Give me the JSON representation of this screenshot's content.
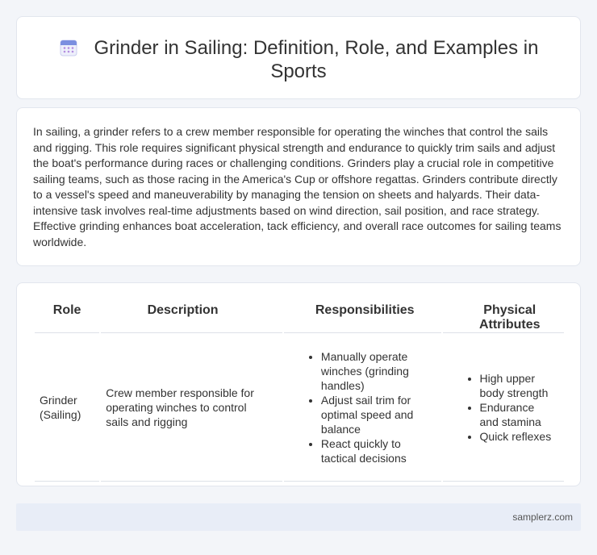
{
  "header": {
    "title": "Grinder in Sailing: Definition, Role, and Examples in Sports",
    "icon": "calendar-icon"
  },
  "intro": {
    "text": "In sailing, a grinder refers to a crew member responsible for operating the winches that control the sails and rigging. This role requires significant physical strength and endurance to quickly trim sails and adjust the boat's performance during races or challenging conditions. Grinders play a crucial role in competitive sailing teams, such as those racing in the America's Cup or offshore regattas. Grinders contribute directly to a vessel's speed and maneuverability by managing the tension on sheets and halyards. Their data-intensive task involves real-time adjustments based on wind direction, sail position, and race strategy. Effective grinding enhances boat acceleration, tack efficiency, and overall race outcomes for sailing teams worldwide."
  },
  "table": {
    "headers": [
      "Role",
      "Description",
      "Responsibilities",
      "Physical Attributes"
    ],
    "rows": [
      {
        "role": "Grinder (Sailing)",
        "description": "Crew member responsible for operating winches to control sails and rigging",
        "responsibilities": [
          "Manually operate winches (grinding handles)",
          "Adjust sail trim for optimal speed and balance",
          "React quickly to tactical decisions"
        ],
        "physical_attributes": [
          "High upper body strength",
          "Endurance and stamina",
          "Quick reflexes"
        ]
      }
    ]
  },
  "footer": {
    "text": "samplerz.com"
  }
}
